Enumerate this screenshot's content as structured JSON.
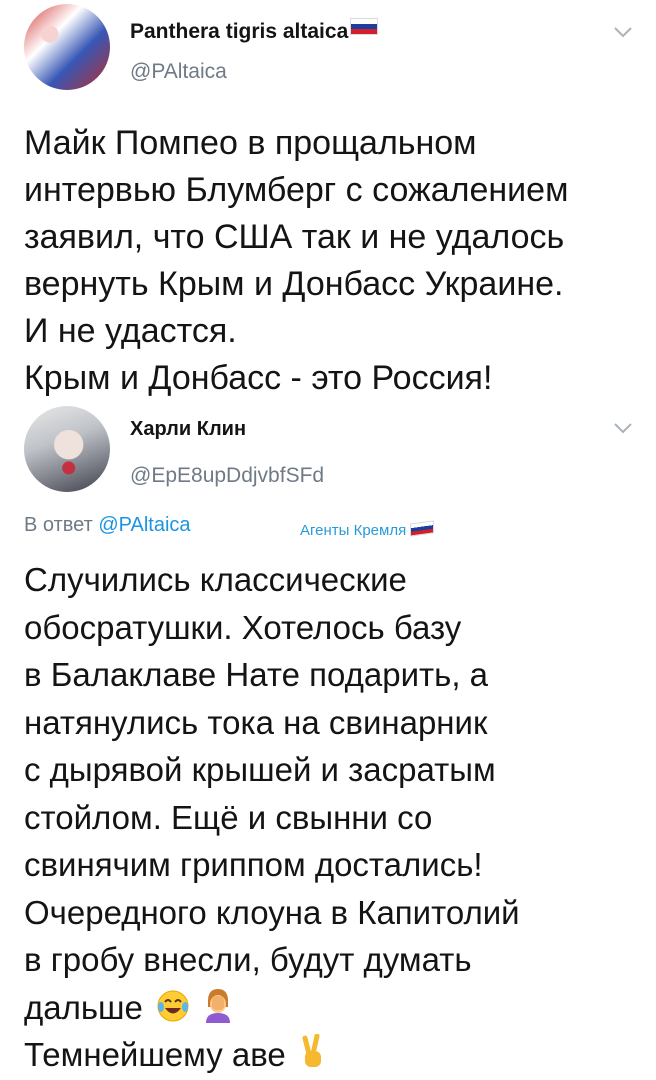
{
  "tweet1": {
    "author_name": "Panthera tigris altaica",
    "handle": "@PAltaica",
    "lines": [
      "Майк Помпео в прощальном",
      "интервью Блумберг с сожалением",
      "заявил, что США так и не удалось",
      "вернуть Крым и Донбасс Украине.",
      "И не удастся.",
      "Крым и Донбасс - это Россия!"
    ]
  },
  "tweet2": {
    "author_name": "Харли Клин",
    "handle": "@EpE8upDdjvbfSFd",
    "reply_prefix": "В ответ ",
    "reply_handle": "@PAltaica",
    "tag": "Агенты Кремля",
    "lines": [
      "Случились классические",
      "обосратушки. Хотелось базу",
      "в Балаклаве Нате подарить, а",
      "натянулись тока на свинарник",
      "с дырявой крышей и засратым",
      "стойлом. Ещё и свынни со",
      "свинячим гриппом достались!",
      "Очередного клоуна в Капитолий",
      "в гробу внесли, будут думать",
      "дальше",
      "Темнейшему аве"
    ]
  },
  "icons": {
    "flag": "russia-flag-icon",
    "menu": "chevron-down-icon",
    "laugh": "tears-of-joy-emoji",
    "facepalm": "facepalm-emoji",
    "victory": "victory-hand-emoji"
  },
  "colors": {
    "text": "#141414",
    "secondary": "#6f7a86",
    "link": "#1b95e0"
  }
}
